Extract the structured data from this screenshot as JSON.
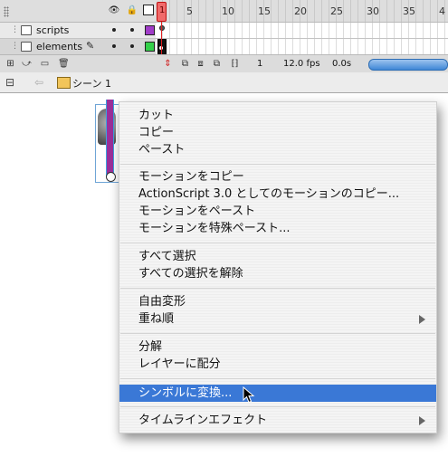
{
  "timeline": {
    "frame_numbers": [
      "1",
      "5",
      "10",
      "15",
      "20",
      "25",
      "30",
      "35",
      "4"
    ],
    "layers": [
      {
        "name": "scripts",
        "color": "#a03cc8"
      },
      {
        "name": "elements",
        "color": "#34d14a"
      }
    ],
    "current_frame": "1",
    "fps": "12.0 fps",
    "elapsed": "0.0s"
  },
  "edit_bar": {
    "scene_label": "シーン 1"
  },
  "context_menu": {
    "items": [
      {
        "label": "カット",
        "submenu": false
      },
      {
        "label": "コピー",
        "submenu": false
      },
      {
        "label": "ペースト",
        "submenu": false
      },
      {
        "label": "モーションをコピー",
        "submenu": false
      },
      {
        "label": "ActionScript 3.0 としてのモーションのコピー...",
        "submenu": false
      },
      {
        "label": "モーションをペースト",
        "submenu": false
      },
      {
        "label": "モーションを特殊ペースト...",
        "submenu": false
      },
      {
        "label": "すべて選択",
        "submenu": false
      },
      {
        "label": "すべての選択を解除",
        "submenu": false
      },
      {
        "label": "自由変形",
        "submenu": false
      },
      {
        "label": "重ね順",
        "submenu": true
      },
      {
        "label": "分解",
        "submenu": false
      },
      {
        "label": "レイヤーに配分",
        "submenu": false
      },
      {
        "label": "シンボルに変換...",
        "submenu": false,
        "highlighted": true
      },
      {
        "label": "タイムラインエフェクト",
        "submenu": true
      }
    ]
  },
  "colors": {
    "highlight": "#3a78d6",
    "playhead": "#e02020",
    "selection": "#6fa5d6"
  }
}
